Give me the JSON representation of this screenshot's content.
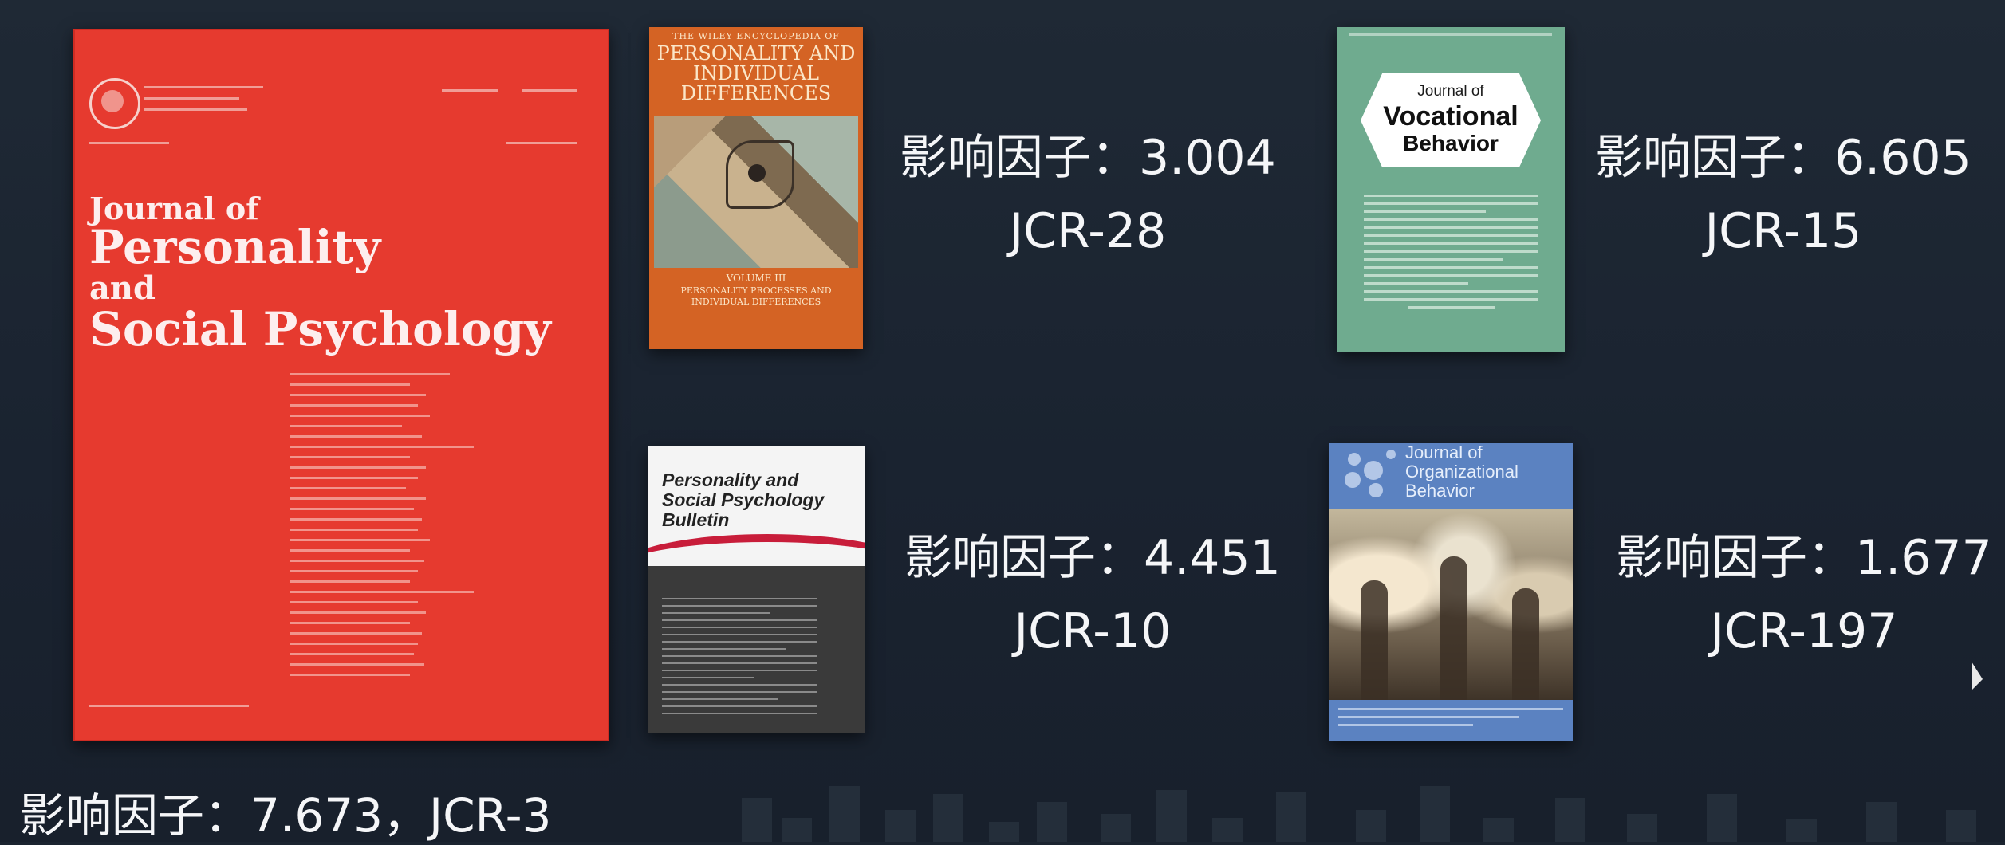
{
  "covers": {
    "jpsp": {
      "line1": "Journal of",
      "line2": "Personality",
      "line3": "and",
      "line4": "Social Psychology"
    },
    "encyclopedia": {
      "series": "THE WILEY ENCYCLOPEDIA OF",
      "title": "PERSONALITY AND INDIVIDUAL DIFFERENCES",
      "volume": "VOLUME III",
      "subtitle": "PERSONALITY PROCESSES AND INDIVIDUAL DIFFERENCES"
    },
    "vocational": {
      "pre": "Journal of",
      "title_1": "Vocational",
      "title_2": "Behavior"
    },
    "pspb": {
      "title_1": "Personality and",
      "title_2": "Social Psychology",
      "title_3": "Bulletin"
    },
    "organizational": {
      "pre": "Journal of",
      "title_1": "Organizational",
      "title_2": "Behavior"
    }
  },
  "labels": {
    "encyclopedia": {
      "impact": "影响因子：3.004",
      "jcr": "JCR-28"
    },
    "vocational": {
      "impact": "影响因子：6.605",
      "jcr": "JCR-15"
    },
    "pspb": {
      "impact": "影响因子：4.451",
      "jcr": "JCR-10"
    },
    "organizational": {
      "impact": "影响因子：1.677",
      "jcr": "JCR-197"
    },
    "jpsp": "影响因子：7.673，JCR-3"
  },
  "colors": {
    "background": "#1b2430",
    "jpsp_red": "#e63a2f",
    "encyclopedia_orange": "#d46324",
    "vocational_green": "#6fab8f",
    "organizational_blue": "#5b82c1",
    "pspb_red": "#c81d3a"
  }
}
